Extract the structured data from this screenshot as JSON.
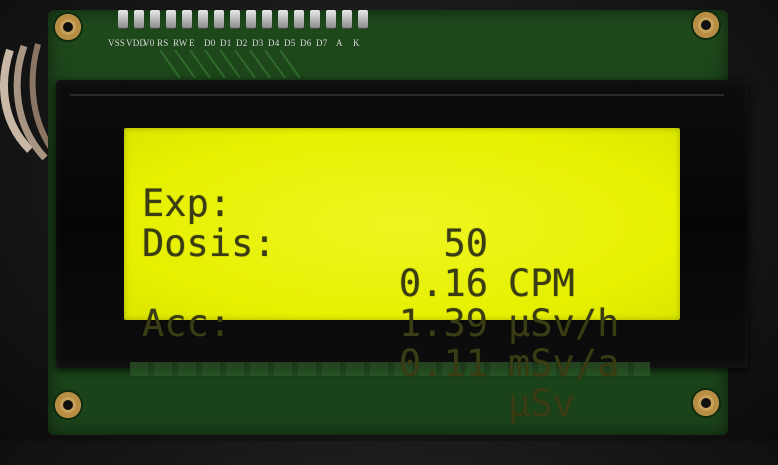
{
  "pins": {
    "labels": [
      "VSS",
      "VDD",
      "V0",
      "RS",
      "RW",
      "E",
      "D0",
      "D1",
      "D2",
      "D3",
      "D4",
      "D5",
      "D6",
      "D7",
      "A",
      "K"
    ]
  },
  "display": {
    "rows": [
      {
        "label": "Exp:",
        "value": "50",
        "unit": "CPM"
      },
      {
        "label": "Dosis:",
        "value": "0.16",
        "unit": "µSv/h"
      },
      {
        "label": "",
        "value": "1.39",
        "unit": "mSv/a"
      },
      {
        "label": "Acc:",
        "value": "0.11",
        "unit": "µSv"
      }
    ]
  },
  "colors": {
    "lcd_background": "#e6f000",
    "lcd_text": "#3a3c14",
    "pcb": "#1b441a"
  }
}
